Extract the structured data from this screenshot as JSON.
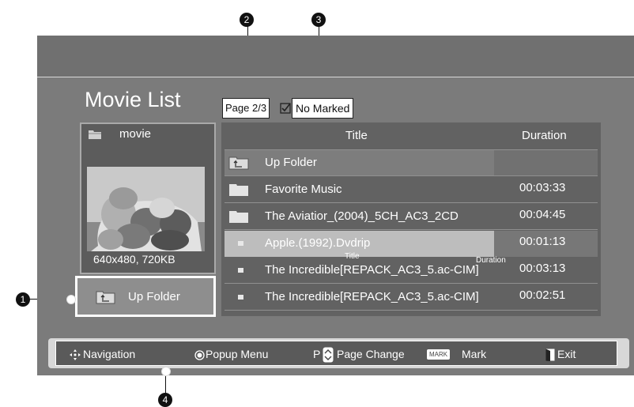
{
  "header": {
    "title": "Movie List"
  },
  "status": {
    "page": "Page 2/3",
    "marked": "No Marked"
  },
  "preview": {
    "folder_name": "movie",
    "resolution": "640x480, 720KB"
  },
  "up_folder_button": {
    "label": "Up Folder"
  },
  "list": {
    "columns": {
      "title": "Title",
      "duration": "Duration"
    },
    "rows": [
      {
        "icon": "up-folder-icon",
        "name": "Up Folder",
        "duration": ""
      },
      {
        "icon": "folder-icon",
        "name": "Favorite Music",
        "duration": "00:03:33"
      },
      {
        "icon": "folder-icon",
        "name": "The Aviatior_(2004)_5CH_AC3_2CD",
        "duration": "00:04:45"
      },
      {
        "icon": "file-bullet-icon",
        "name": "Apple.(1992).Dvdrip",
        "duration": "00:01:13"
      },
      {
        "icon": "file-bullet-icon",
        "name": "The Incredible[REPACK_AC3_5.ac-CIM]",
        "duration": "00:03:13"
      },
      {
        "icon": "file-bullet-icon",
        "name": "The Incredible[REPACK_AC3_5.ac-CIM]",
        "duration": "00:02:51"
      }
    ],
    "overlay_title": "Title",
    "overlay_duration": "Duration"
  },
  "footer": {
    "navigation": "Navigation",
    "popup_menu": "Popup Menu",
    "page_key": "P",
    "page_change": "Page Change",
    "mark_key": "MARK",
    "mark": "Mark",
    "exit": "Exit"
  },
  "callouts": [
    "1",
    "2",
    "3",
    "4"
  ],
  "colors": {
    "panel": "#7b7b7b",
    "list_bg": "#626262",
    "highlight": "#b9b9b9",
    "footer": "#5a5a5a"
  }
}
